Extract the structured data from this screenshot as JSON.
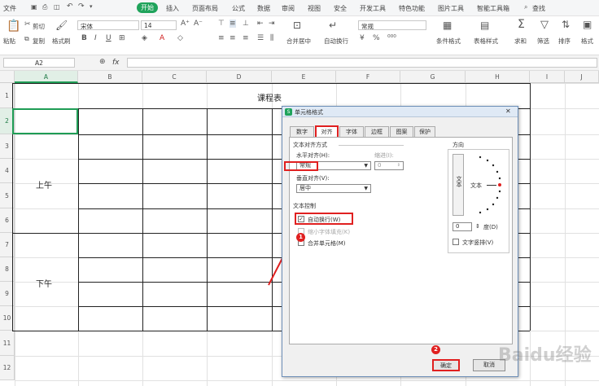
{
  "menubar": {
    "file": "文件",
    "start": "开始",
    "insert": "插入",
    "page_layout": "页面布局",
    "formula": "公式",
    "data": "数据",
    "review": "审阅",
    "view": "视图",
    "security": "安全",
    "dev_tools": "开发工具",
    "special": "特色功能",
    "picture_tools": "图片工具",
    "smart_toolbox": "智能工具箱",
    "search": "查找"
  },
  "ribbon": {
    "cut": "剪切",
    "paste": "粘贴",
    "copy": "复制",
    "format_painter": "格式刷",
    "font_name": "宋体",
    "font_size": "14",
    "merge_center": "合并居中",
    "wrap_text": "自动换行",
    "number_format": "常规",
    "conditional_format": "条件格式",
    "table_style": "表格样式",
    "sum": "求和",
    "filter": "筛选",
    "sort": "排序",
    "fmt": "格式"
  },
  "formulabar": {
    "cell_ref": "A2",
    "fx": "fx"
  },
  "columns": [
    "A",
    "B",
    "C",
    "D",
    "E",
    "F",
    "G",
    "H",
    "I",
    "J"
  ],
  "rows": [
    "1",
    "2",
    "3",
    "4",
    "5",
    "6",
    "7",
    "8",
    "9",
    "10",
    "11",
    "12"
  ],
  "sheet": {
    "title": "课程表",
    "morning": "上午",
    "afternoon": "下午"
  },
  "dialog": {
    "title": "单元格格式",
    "tabs": [
      "数字",
      "对齐",
      "字体",
      "边框",
      "图案",
      "保护"
    ],
    "text_align_section": "文本对齐方式",
    "horizontal_label": "水平对齐(H):",
    "horizontal_value": "常规",
    "indent_label": "缩进(I):",
    "indent_value": "0",
    "vertical_label": "垂直对齐(V):",
    "vertical_value": "居中",
    "text_control_section": "文本控制",
    "wrap_text": "自动换行(W)",
    "shrink_to_fit": "缩小字体填充(K)",
    "merge_cells": "合并单元格(M)",
    "orientation_section": "方向",
    "vertical_text": "文本",
    "orientation_text": "文本",
    "degrees_value": "0",
    "degrees_label": "度(D)",
    "vertical_text_checkbox": "文字竖排(V)",
    "ok": "确定",
    "cancel": "取消",
    "wrap_checked": true,
    "active_tab": "对齐"
  },
  "annotations": {
    "badge1": "1",
    "badge2": "2",
    "accent": "#e02020"
  },
  "watermark": "Baidu经验"
}
